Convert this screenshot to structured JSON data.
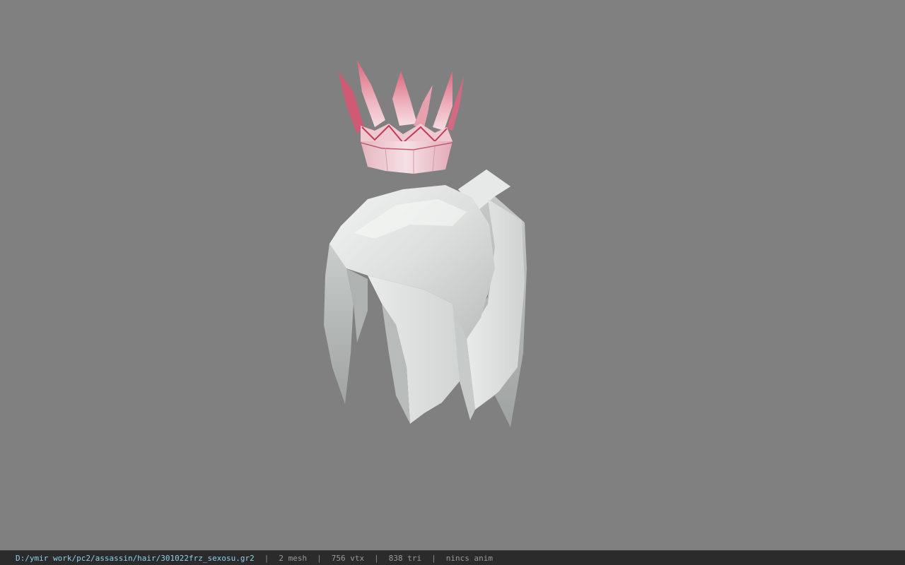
{
  "viewer": {
    "background": "#808080",
    "model_parts": [
      {
        "name": "crown",
        "color": "#e9a0ae"
      },
      {
        "name": "hair",
        "color": "#dfe3e1"
      }
    ]
  },
  "status_bar": {
    "file_path": "D:/ymir work/pc2/assassin/hair/301022frz_sexosu.gr2",
    "separator": "|",
    "mesh_count": "2 mesh",
    "vertex_count": "756 vtx",
    "triangle_count": "838 tri",
    "anim_status": "nincs anim"
  }
}
